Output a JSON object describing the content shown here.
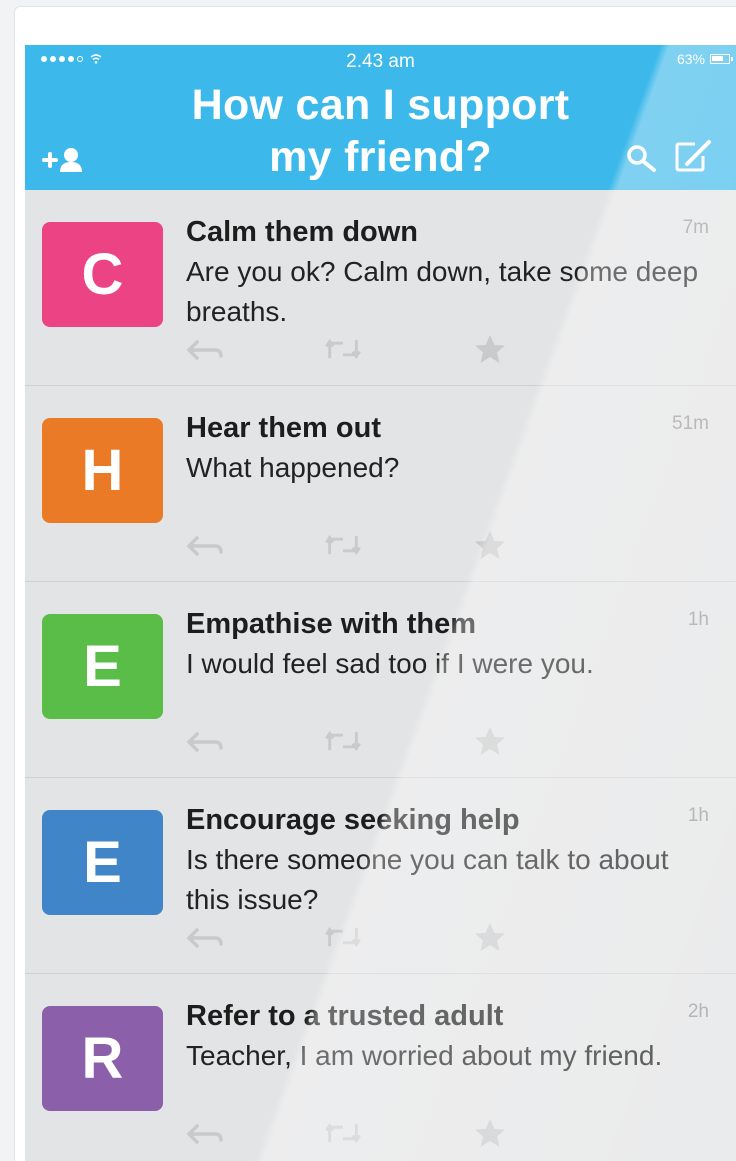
{
  "status_bar": {
    "time": "2.43 am",
    "battery": "63%"
  },
  "header": {
    "title_line1": "How can I support",
    "title_line2": "my friend?"
  },
  "colors": {
    "header_bg": "#3cb9ea",
    "avatar_c": "#ec4384",
    "avatar_h": "#ea7a25",
    "avatar_e1": "#5abd48",
    "avatar_e2": "#3f85c8",
    "avatar_r": "#8b5fa9"
  },
  "icons": [
    "signal-dots-icon",
    "wifi-icon",
    "battery-icon",
    "add-user-icon",
    "search-icon",
    "compose-icon",
    "reply-icon",
    "retweet-icon",
    "star-icon"
  ],
  "feed": {
    "items": [
      {
        "letter": "C",
        "title": "Calm them down",
        "time": "7m",
        "body": "Are you ok? Calm down, take some deep breaths."
      },
      {
        "letter": "H",
        "title": "Hear them out",
        "time": "51m",
        "body": "What happened?"
      },
      {
        "letter": "E",
        "title": "Empathise with them",
        "time": "1h",
        "body": "I would feel sad too if I were you."
      },
      {
        "letter": "E",
        "title": "Encourage seeking help",
        "time": "1h",
        "body": "Is there someone you can talk to about this issue?"
      },
      {
        "letter": "R",
        "title": "Refer to a trusted adult",
        "time": "2h",
        "body": "Teacher, I am worried about my friend."
      }
    ]
  }
}
